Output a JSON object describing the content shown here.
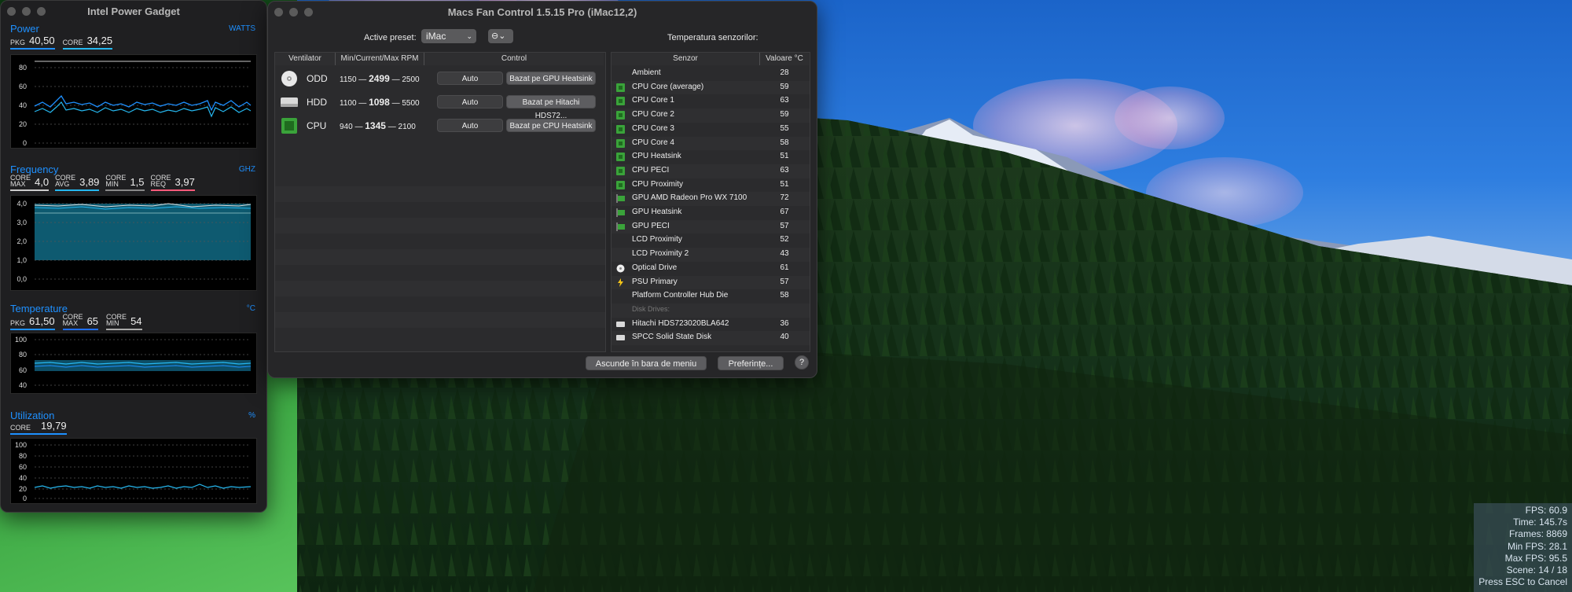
{
  "power_gadget": {
    "title": "Intel Power Gadget",
    "power": {
      "title": "Power",
      "unit": "WATTS",
      "metrics": [
        {
          "label": "PKG",
          "value": "40,50"
        },
        {
          "label": "CORE",
          "value": "34,25"
        }
      ],
      "y_ticks": [
        "80",
        "60",
        "40",
        "20",
        "0"
      ]
    },
    "frequency": {
      "title": "Frequency",
      "unit": "GHZ",
      "metrics": [
        {
          "label1": "CORE",
          "label2": "MAX",
          "value": "4,0"
        },
        {
          "label1": "CORE",
          "label2": "AVG",
          "value": "3,89"
        },
        {
          "label1": "CORE",
          "label2": "MIN",
          "value": "1,5"
        },
        {
          "label1": "CORE",
          "label2": "REQ",
          "value": "3,97"
        }
      ],
      "y_ticks": [
        "4,0",
        "3,0",
        "2,0",
        "1,0",
        "0,0"
      ]
    },
    "temperature": {
      "title": "Temperature",
      "unit": "°C",
      "metrics": [
        {
          "label1": "",
          "label2": "PKG",
          "value": "61,50"
        },
        {
          "label1": "CORE",
          "label2": "MAX",
          "value": "65"
        },
        {
          "label1": "CORE",
          "label2": "MIN",
          "value": "54"
        }
      ],
      "y_ticks": [
        "100",
        "80",
        "60",
        "40"
      ]
    },
    "utilization": {
      "title": "Utilization",
      "unit": "%",
      "metrics": [
        {
          "label": "CORE",
          "value": "19,79"
        }
      ],
      "y_ticks": [
        "100",
        "80",
        "60",
        "40",
        "20",
        "0"
      ]
    },
    "colors": {
      "accent": "#1e90ff",
      "line": "#26b8f0"
    }
  },
  "fan_control": {
    "title": "Macs Fan Control 1.5.15 Pro (iMac12,2)",
    "preset_label": "Active preset:",
    "preset_value": "iMac",
    "sensors_title": "Temperatura senzorilor:",
    "fan_headers": {
      "fan": "Ventilator",
      "rpm": "Min/Current/Max RPM",
      "control": "Control"
    },
    "fans": [
      {
        "name": "ODD",
        "min": "1150 —",
        "current": "2499",
        "max": "— 2500",
        "auto": "Auto",
        "source": "Bazat pe GPU Heatsink"
      },
      {
        "name": "HDD",
        "min": "1100 —",
        "current": "1098",
        "max": "— 5500",
        "auto": "Auto",
        "source": "Bazat pe Hitachi HDS72..."
      },
      {
        "name": "CPU",
        "min": "940 —",
        "current": "1345",
        "max": "— 2100",
        "auto": "Auto",
        "source": "Bazat pe CPU Heatsink"
      }
    ],
    "sensor_headers": {
      "sensor": "Senzor",
      "value": "Valoare °C"
    },
    "sensors": [
      {
        "name": "Ambient",
        "value": "28",
        "icon": "none"
      },
      {
        "name": "CPU Core (average)",
        "value": "59",
        "icon": "chip"
      },
      {
        "name": "CPU Core 1",
        "value": "63",
        "icon": "chip"
      },
      {
        "name": "CPU Core 2",
        "value": "59",
        "icon": "chip"
      },
      {
        "name": "CPU Core 3",
        "value": "55",
        "icon": "chip"
      },
      {
        "name": "CPU Core 4",
        "value": "58",
        "icon": "chip"
      },
      {
        "name": "CPU Heatsink",
        "value": "51",
        "icon": "chip"
      },
      {
        "name": "CPU PECI",
        "value": "63",
        "icon": "chip"
      },
      {
        "name": "CPU Proximity",
        "value": "51",
        "icon": "chip"
      },
      {
        "name": "GPU AMD Radeon Pro WX 7100",
        "value": "72",
        "icon": "gpu"
      },
      {
        "name": "GPU Heatsink",
        "value": "67",
        "icon": "gpu"
      },
      {
        "name": "GPU PECI",
        "value": "57",
        "icon": "gpu"
      },
      {
        "name": "LCD Proximity",
        "value": "52",
        "icon": "none"
      },
      {
        "name": "LCD Proximity 2",
        "value": "43",
        "icon": "none"
      },
      {
        "name": "Optical Drive",
        "value": "61",
        "icon": "disc"
      },
      {
        "name": "PSU Primary",
        "value": "57",
        "icon": "bolt"
      },
      {
        "name": "Platform Controller Hub Die",
        "value": "58",
        "icon": "none"
      },
      {
        "name": "Disk Drives:",
        "value": "",
        "icon": "header"
      },
      {
        "name": "Hitachi HDS723020BLA642",
        "value": "36",
        "icon": "disk"
      },
      {
        "name": "SPCC Solid State Disk",
        "value": "40",
        "icon": "disk"
      }
    ],
    "hide_button": "Ascunde în bara de meniu",
    "prefs_button": "Preferințe...",
    "help_button": "?"
  },
  "fps_overlay": {
    "lines": [
      "FPS: 60.9",
      "Time: 145.7s",
      "Frames: 8869",
      "Min FPS: 28.1",
      "Max FPS: 95.5",
      "Scene: 14 / 18",
      "Press ESC to Cancel"
    ]
  }
}
